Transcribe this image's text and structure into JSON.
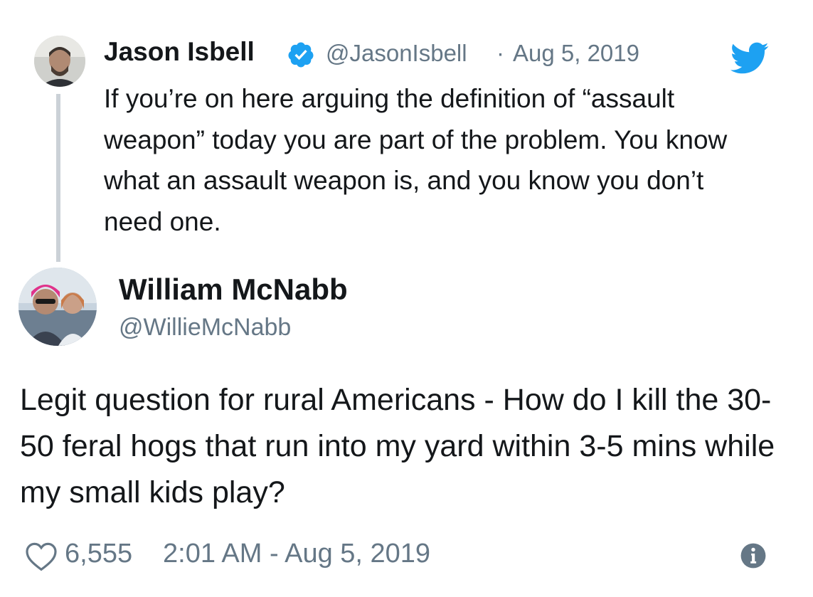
{
  "parent_tweet": {
    "author_name": "Jason Isbell",
    "handle": "@JasonIsbell",
    "separator": "·",
    "date": "Aug 5, 2019",
    "text": "If you’re on here arguing the definition of “assault weapon” today you are part of the problem. You know what an assault weapon is, and you know you don’t need one."
  },
  "reply_tweet": {
    "author_name": "William McNabb",
    "handle": "@WillieMcNabb",
    "text": "Legit question for rural Americans - How do I kill the 30-50 feral hogs that run into my yard within 3-5 mins while my small kids play?",
    "likes": "6,555",
    "timestamp": "2:01 AM - Aug 5, 2019"
  },
  "icons": {
    "verified": "verified-badge-icon",
    "brand": "twitter-bird-icon",
    "like": "heart-icon",
    "info": "info-icon"
  },
  "colors": {
    "text": "#14171a",
    "secondary": "#657786",
    "accent": "#1da1f2",
    "thread_line": "#cbd1d7"
  }
}
